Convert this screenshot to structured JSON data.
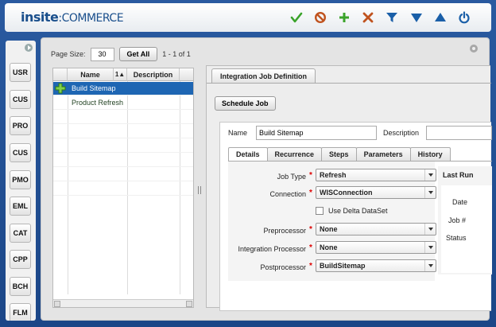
{
  "header": {
    "logo_bold": "insite",
    "logo_rest": ":COMMERCE",
    "toolbar": [
      {
        "icon": "check-icon",
        "color": "#3aa32a"
      },
      {
        "icon": "cancel-icon",
        "color": "#c0531f"
      },
      {
        "icon": "add-icon",
        "color": "#3aa32a"
      },
      {
        "icon": "delete-icon",
        "color": "#c0531f"
      },
      {
        "icon": "filter-icon",
        "color": "#1a5fa8"
      },
      {
        "icon": "sort-descending-icon",
        "color": "#1a5fa8"
      },
      {
        "icon": "sort-ascending-icon",
        "color": "#1a5fa8"
      },
      {
        "icon": "power-icon",
        "color": "#1a5fa8"
      }
    ]
  },
  "rail": {
    "items": [
      "USR",
      "CUS",
      "PRO",
      "CUS",
      "PMO",
      "EML",
      "CAT",
      "CPP",
      "BCH",
      "FLM"
    ]
  },
  "pager": {
    "page_size_label": "Page Size:",
    "page_size_value": "30",
    "get_all_label": "Get All",
    "range_text": "1 - 1 of 1"
  },
  "grid": {
    "columns": {
      "name": "Name",
      "sort": "1▲",
      "description": "Description"
    },
    "rows": [
      {
        "name": "Build Sitemap",
        "selected": true
      },
      {
        "name": "Product Refresh",
        "selected": false
      }
    ]
  },
  "detail": {
    "tab_title": "Integration Job Definition",
    "schedule_button": "Schedule Job",
    "name_label": "Name",
    "name_value": "Build Sitemap",
    "description_label": "Description",
    "description_value": "",
    "subtabs": [
      "Details",
      "Recurrence",
      "Steps",
      "Parameters",
      "History"
    ],
    "active_subtab": "Details",
    "fields": {
      "job_type": {
        "label": "Job Type",
        "value": "Refresh"
      },
      "connection": {
        "label": "Connection",
        "value": "WISConnection"
      },
      "delta": {
        "label": "Use Delta DataSet",
        "checked": false
      },
      "preprocessor": {
        "label": "Preprocessor",
        "value": "None"
      },
      "integration_processor": {
        "label": "Integration Processor",
        "value": "None"
      },
      "postprocessor": {
        "label": "Postprocessor",
        "value": "BuildSitemap"
      }
    },
    "last_run": {
      "title": "Last Run",
      "date_label": "Date",
      "job_label": "Job #",
      "status_label": "Status"
    }
  }
}
